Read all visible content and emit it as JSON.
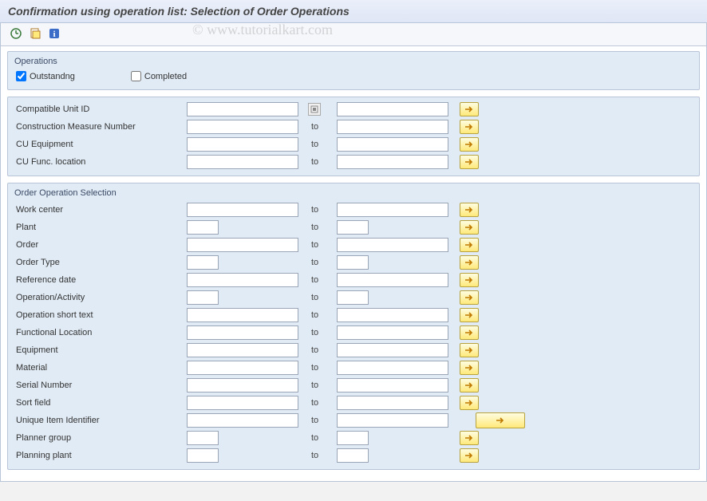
{
  "title": "Confirmation using operation list: Selection of Order Operations",
  "watermark": "© www.tutorialkart.com",
  "operations_group": {
    "title": "Operations",
    "outstanding": {
      "label": "Outstandng",
      "checked": true
    },
    "completed": {
      "label": "Completed",
      "checked": false
    }
  },
  "cu_group": {
    "rows": [
      {
        "label": "Compatible Unit ID",
        "from_w": "w-long",
        "to_w": "w-long",
        "to": "",
        "search_help": true
      },
      {
        "label": "Construction Measure Number",
        "from_w": "w-long",
        "to_w": "w-long",
        "to": "to"
      },
      {
        "label": "CU Equipment",
        "from_w": "w-long",
        "to_w": "w-long",
        "to": "to"
      },
      {
        "label": "CU Func. location",
        "from_w": "w-long",
        "to_w": "w-long",
        "to": "to"
      }
    ]
  },
  "order_group": {
    "title": "Order Operation Selection",
    "rows": [
      {
        "label": "Work center",
        "from_w": "w-long",
        "to_w": "w-long",
        "to": "to"
      },
      {
        "label": "Plant",
        "from_w": "w-xs",
        "to_w": "w-xs",
        "to": "to"
      },
      {
        "label": "Order",
        "from_w": "w-long",
        "to_w": "w-long",
        "to": "to"
      },
      {
        "label": "Order Type",
        "from_w": "w-xs",
        "to_w": "w-xs",
        "to": "to"
      },
      {
        "label": "Reference date",
        "from_w": "w-long",
        "to_w": "w-long",
        "to": "to"
      },
      {
        "label": "Operation/Activity",
        "from_w": "w-xs",
        "to_w": "w-xs",
        "to": "to"
      },
      {
        "label": "Operation short text",
        "from_w": "w-long",
        "to_w": "w-long",
        "to": "to"
      },
      {
        "label": "Functional Location",
        "from_w": "w-long",
        "to_w": "w-long",
        "to": "to"
      },
      {
        "label": "Equipment",
        "from_w": "w-long",
        "to_w": "w-long",
        "to": "to"
      },
      {
        "label": "Material",
        "from_w": "w-long",
        "to_w": "w-long",
        "to": "to"
      },
      {
        "label": "Serial Number",
        "from_w": "w-long",
        "to_w": "w-long",
        "to": "to"
      },
      {
        "label": "Sort field",
        "from_w": "w-long",
        "to_w": "w-long",
        "to": "to"
      },
      {
        "label": "Unique Item Identifier",
        "from_w": "w-long",
        "to_w": "w-long",
        "to": "to",
        "wide_btn": true
      },
      {
        "label": "Planner group",
        "from_w": "w-xs",
        "to_w": "w-xs",
        "to": "to"
      },
      {
        "label": "Planning plant",
        "from_w": "w-xs",
        "to_w": "w-xs",
        "to": "to"
      }
    ]
  },
  "to_label": "to"
}
